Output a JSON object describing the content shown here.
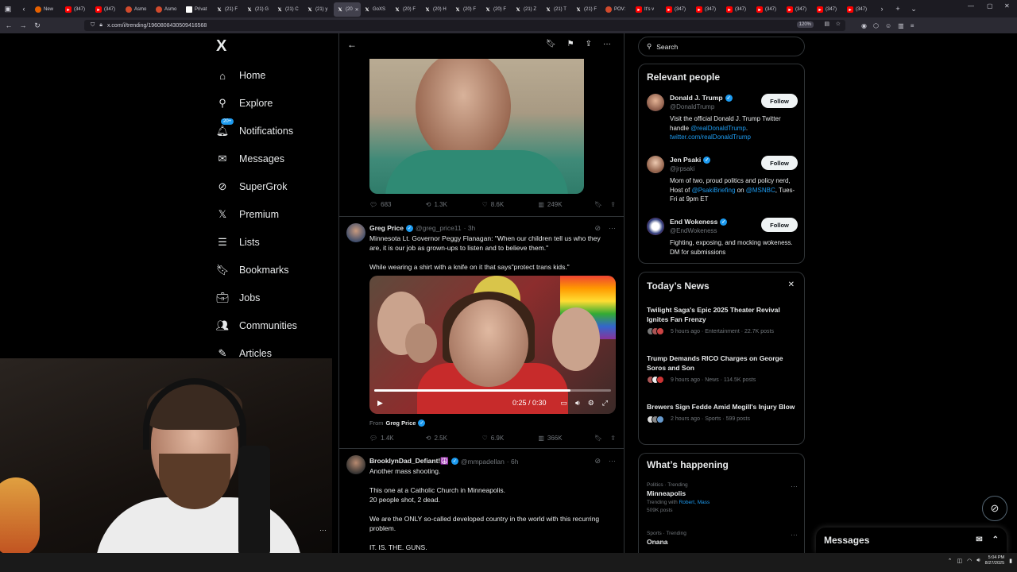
{
  "browser": {
    "tabs": [
      {
        "label": "New",
        "icon": "fox"
      },
      {
        "label": "(347)",
        "icon": "yt"
      },
      {
        "label": "(347)",
        "icon": "yt"
      },
      {
        "label": "Asmo",
        "icon": "asmon"
      },
      {
        "label": "Asmo",
        "icon": "asmon"
      },
      {
        "label": "Privat",
        "icon": "priv"
      },
      {
        "label": "(21) F",
        "icon": "x"
      },
      {
        "label": "(21) G",
        "icon": "x"
      },
      {
        "label": "(21) C",
        "icon": "x"
      },
      {
        "label": "(21) y",
        "icon": "x"
      },
      {
        "label": "(20",
        "icon": "x",
        "active": true
      },
      {
        "label": "GoXS",
        "icon": "x"
      },
      {
        "label": "(20) F",
        "icon": "x"
      },
      {
        "label": "(20) H",
        "icon": "x"
      },
      {
        "label": "(20) F",
        "icon": "x"
      },
      {
        "label": "(20) F",
        "icon": "x"
      },
      {
        "label": "(21) Z",
        "icon": "x"
      },
      {
        "label": "(21) T",
        "icon": "x"
      },
      {
        "label": "(21) F",
        "icon": "x"
      },
      {
        "label": "POV:",
        "icon": "asmon"
      },
      {
        "label": "It's v",
        "icon": "yt"
      },
      {
        "label": "(347)",
        "icon": "yt"
      },
      {
        "label": "(347)",
        "icon": "yt"
      },
      {
        "label": "(347)",
        "icon": "yt"
      },
      {
        "label": "(347)",
        "icon": "yt"
      },
      {
        "label": "(347)",
        "icon": "yt"
      },
      {
        "label": "(347)",
        "icon": "yt"
      },
      {
        "label": "(347)",
        "icon": "yt"
      }
    ],
    "url": "x.com/i/trending/1960808430509416568",
    "zoom": "120%"
  },
  "nav": {
    "logo": "X",
    "notif_badge": "20+",
    "items": [
      {
        "label": "Home",
        "icon": "home-icon"
      },
      {
        "label": "Explore",
        "icon": "search-icon"
      },
      {
        "label": "Notifications",
        "icon": "bell-icon"
      },
      {
        "label": "Messages",
        "icon": "envelope-icon"
      },
      {
        "label": "SuperGrok",
        "icon": "grok-icon"
      },
      {
        "label": "Premium",
        "icon": "x-icon"
      },
      {
        "label": "Lists",
        "icon": "list-icon"
      },
      {
        "label": "Bookmarks",
        "icon": "bookmark-icon"
      },
      {
        "label": "Jobs",
        "icon": "briefcase-icon"
      },
      {
        "label": "Communities",
        "icon": "people-icon"
      },
      {
        "label": "Articles",
        "icon": "article-icon"
      }
    ]
  },
  "feed": {
    "tweet1_stats": {
      "replies": "683",
      "reposts": "1.3K",
      "likes": "8.6K",
      "views": "249K"
    },
    "tweet2": {
      "name": "Greg Price",
      "handle": "@greg_price11",
      "time": "· 3h",
      "text": "Minnesota Lt. Governor Peggy Flanagan: \"When our children tell us who they are, it is our job as grown-ups to listen and to believe them.\"\n\nWhile wearing a shirt with a knife on it that says\"protect trans kids.\"",
      "video_time": "0:25 / 0:30",
      "video_progress": 0.83,
      "from_label": "From",
      "from_name": "Greg Price",
      "stats": {
        "replies": "1.4K",
        "reposts": "2.5K",
        "likes": "6.9K",
        "views": "366K"
      }
    },
    "tweet3": {
      "name": "BrooklynDad_Defiant!☮️",
      "handle": "@mmpadellan",
      "time": "· 6h",
      "text": "Another mass shooting.\n\nThis one at a Catholic Church in Minneapolis.\n20 people shot, 2 dead.\n\nWe are the ONLY so-called developed country in the world with this recurring problem.\n\nIT. IS. THE. GUNS."
    }
  },
  "right": {
    "search_placeholder": "Search",
    "relevant_title": "Relevant people",
    "people": [
      {
        "name": "Donald J. Trump",
        "handle": "@DonaldTrump",
        "bio_pre": "Visit the official Donald J. Trump Twitter handle ",
        "bio_link": "@realDonaldTrump",
        "bio_post": ".",
        "bio_link2": "twitter.com/realDonaldTrump",
        "follow": "Follow"
      },
      {
        "name": "Jen Psaki",
        "handle": "@jrpsaki",
        "bio_pre": "Mom of two, proud politics and policy nerd, Host of ",
        "bio_link": "@PsakiBriefing",
        "bio_post": " on ",
        "bio_link2": "@MSNBC",
        "bio_post2": ", Tues-Fri at 9pm ET",
        "follow": "Follow"
      },
      {
        "name": "End Wokeness",
        "handle": "@EndWokeness",
        "bio_pre": "Fighting, exposing, and mocking wokeness. DM for submissions",
        "follow": "Follow"
      }
    ],
    "news_title": "Today’s News",
    "news": [
      {
        "title": "Twilight Saga's Epic 2025 Theater Revival Ignites Fan Frenzy",
        "meta": "5 hours ago · Entertainment · 22.7K posts"
      },
      {
        "title": "Trump Demands RICO Charges on George Soros and Son",
        "meta": "9 hours ago · News · 114.5K posts"
      },
      {
        "title": "Brewers Sign Fedde Amid Megill's Injury Blow",
        "meta": "2 hours ago · Sports · 599 posts"
      }
    ],
    "happening_title": "What’s happening",
    "trends": [
      {
        "category": "Politics · Trending",
        "name": "Minneapolis",
        "with_label": "Trending with",
        "with_links": "Robert, Mass",
        "count": "509K posts"
      },
      {
        "category": "Sports · Trending",
        "name": "Onana"
      }
    ]
  },
  "messages_drawer": {
    "title": "Messages"
  },
  "clock": {
    "time": "5:04 PM",
    "date": "8/27/2025"
  }
}
